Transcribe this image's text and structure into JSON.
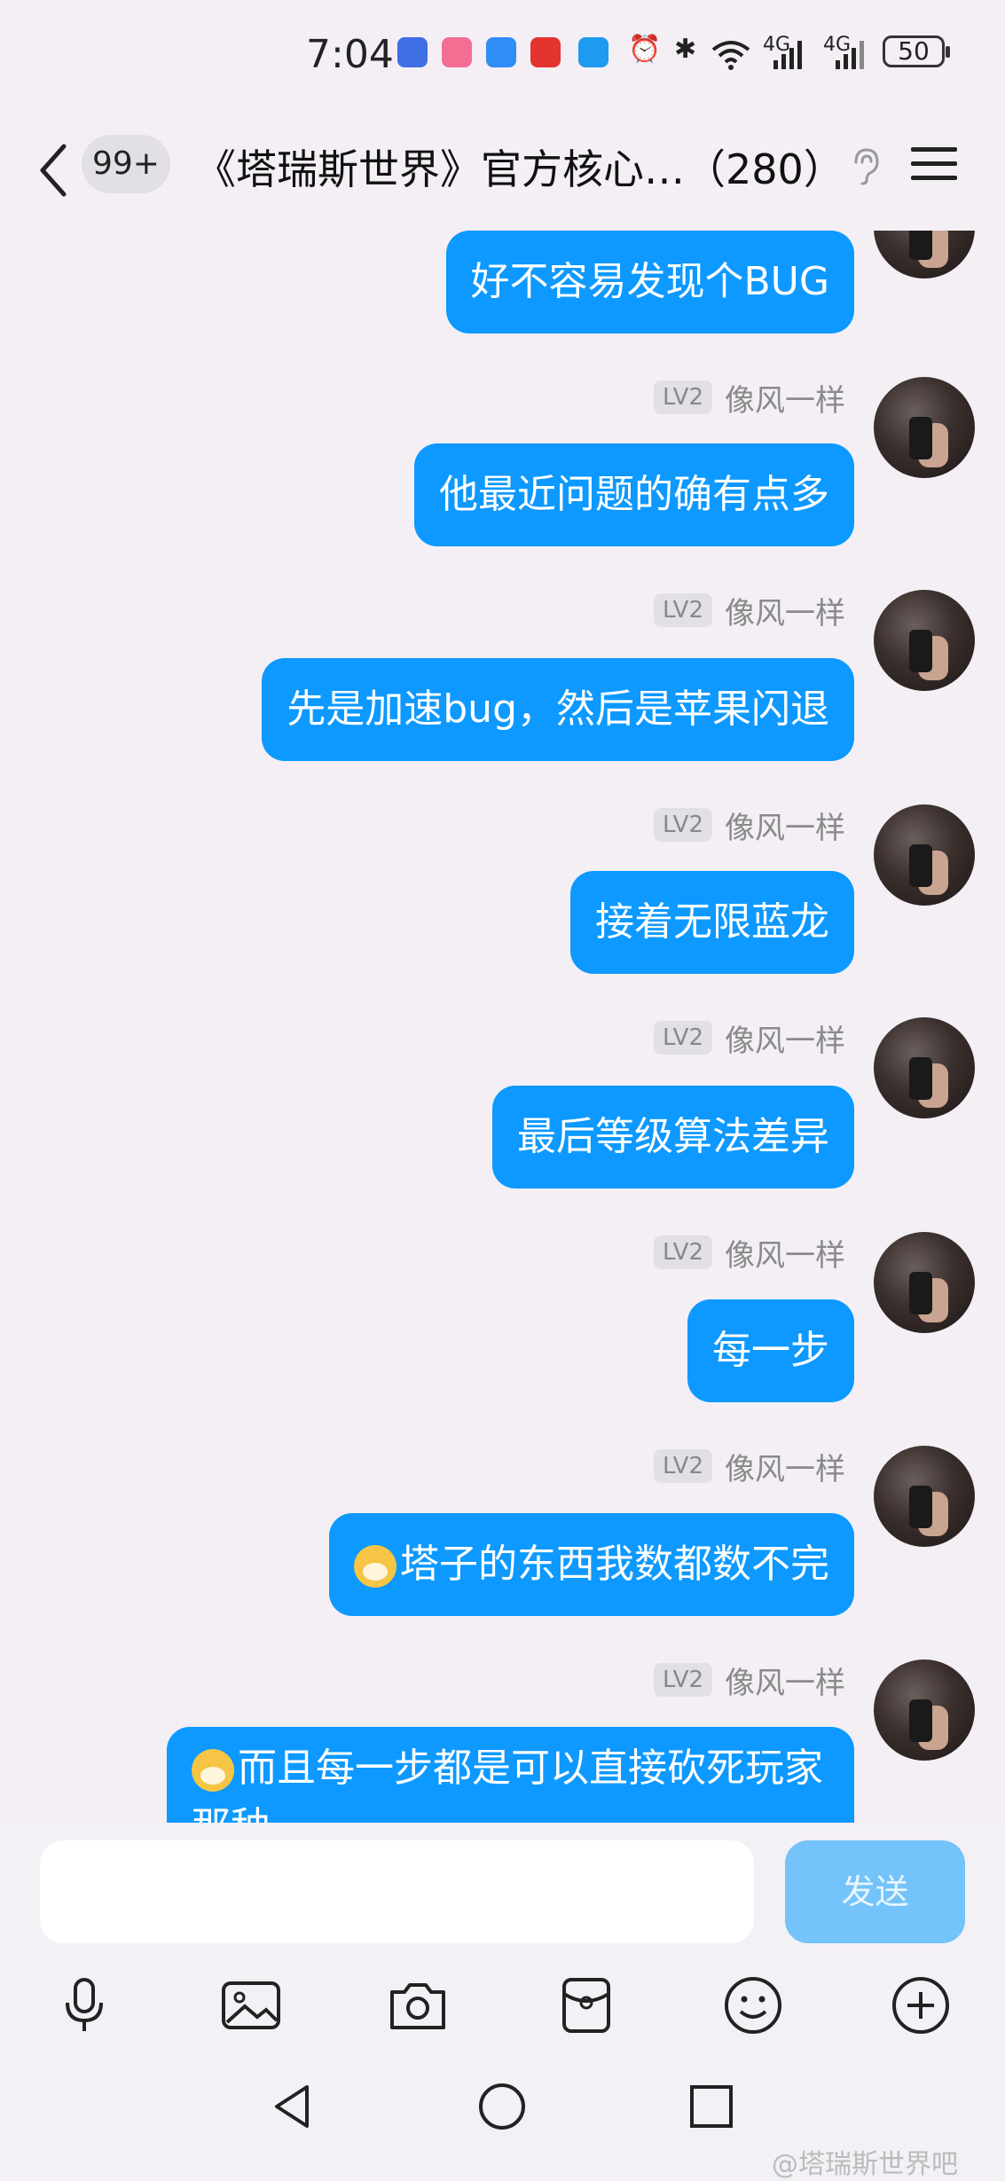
{
  "status_bar": {
    "time": "7:04",
    "net1": "4G",
    "net2": "4G",
    "battery": "50"
  },
  "header": {
    "badge": "99+",
    "title": "《塔瑞斯世界》官方核心…（280）"
  },
  "messages": [
    {
      "text": "好不容易发现个BUG"
    },
    {
      "level": "LV2",
      "sender": "像风一样",
      "text": "他最近问题的确有点多"
    },
    {
      "level": "LV2",
      "sender": "像风一样",
      "text": "先是加速bug，然后是苹果闪退"
    },
    {
      "level": "LV2",
      "sender": "像风一样",
      "text": "接着无限蓝龙"
    },
    {
      "level": "LV2",
      "sender": "像风一样",
      "text": "最后等级算法差异"
    },
    {
      "level": "LV2",
      "sender": "像风一样",
      "text": "每一步"
    },
    {
      "level": "LV2",
      "sender": "像风一样",
      "text": "塔子的东西我数都数不完"
    },
    {
      "level": "LV2",
      "sender": "像风一样",
      "text": "而且每一步都是可以直接砍死玩家那种"
    }
  ],
  "input": {
    "placeholder": "",
    "send_label": "发送"
  },
  "watermark": "@塔瑞斯世界吧"
}
